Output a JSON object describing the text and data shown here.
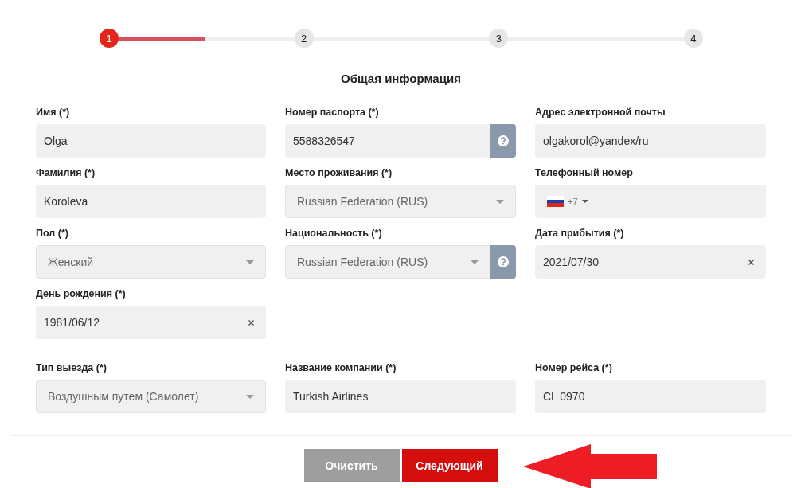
{
  "stepper": {
    "level": 0.165,
    "steps": [
      {
        "label": "1",
        "selected": true
      },
      {
        "label": "2",
        "selected": false
      },
      {
        "label": "3",
        "selected": false
      },
      {
        "label": "4",
        "selected": false
      }
    ]
  },
  "section_title": "Общая информация",
  "rows": [
    {
      "fields": [
        {
          "kind": "text",
          "label": "Имя (*)",
          "value": "Olga",
          "help": false
        },
        {
          "kind": "text",
          "label": "Номер паспорта (*)",
          "value": "5588326547",
          "help": true
        },
        {
          "kind": "text",
          "label": "Адрес электронной почты",
          "value": "olgakorol@yandex/ru",
          "help": false
        }
      ]
    },
    {
      "fields": [
        {
          "kind": "text",
          "label": "Фамилия (*)",
          "value": "Koroleva",
          "help": false
        },
        {
          "kind": "select",
          "label": "Место проживания (*)",
          "value": "Russian Federation (RUS)",
          "help": false
        },
        {
          "kind": "phone",
          "label": "Телефонный номер",
          "dial_code": "+7",
          "help": false
        }
      ]
    },
    {
      "fields": [
        {
          "kind": "select",
          "label": "Пол (*)",
          "value": "Женский",
          "help": false
        },
        {
          "kind": "select",
          "label": "Национальность (*)",
          "value": "Russian Federation (RUS)",
          "help": true
        },
        {
          "kind": "date",
          "label": "Дата прибытия (*)",
          "value": "2021/07/30",
          "help": false
        }
      ]
    },
    {
      "fields": [
        {
          "kind": "date",
          "label": "День рождения (*)",
          "value": "1981/06/12",
          "help": false
        }
      ]
    },
    {
      "fields": [
        {
          "kind": "select",
          "label": "Тип выезда (*)",
          "value": "Воздушным путем (Самолет)",
          "help": false
        },
        {
          "kind": "text",
          "label": "Название компании (*)",
          "value": "Turkish Airlines",
          "help": false
        },
        {
          "kind": "text",
          "label": "Номер рейса (*)",
          "value": "CL 0970",
          "help": false
        }
      ]
    }
  ],
  "buttons": [
    {
      "kind": "secondary",
      "label": "Очистить"
    },
    {
      "kind": "primary",
      "label": "Следующий"
    }
  ]
}
